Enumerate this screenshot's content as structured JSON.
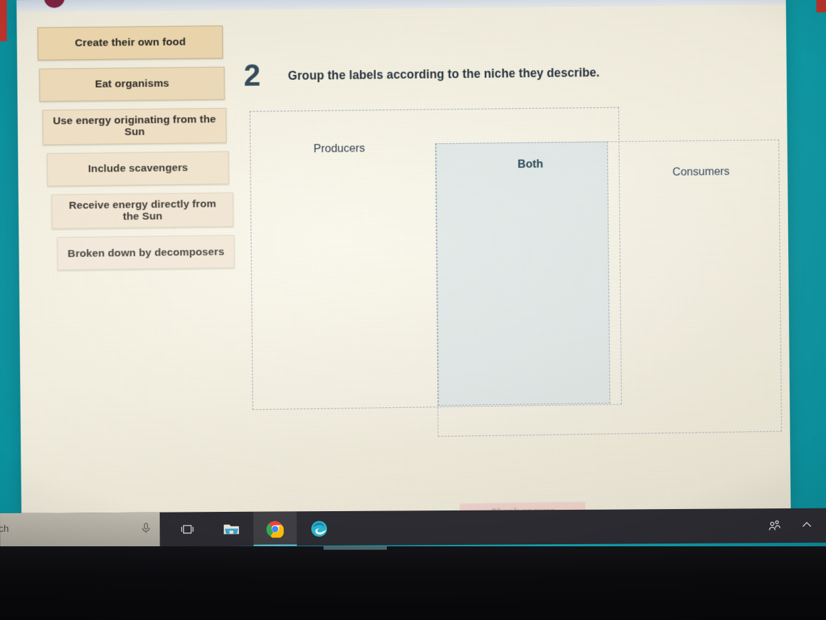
{
  "activity": {
    "question_number": "2",
    "prompt": "Group the labels according to the niche they describe.",
    "labels": [
      {
        "text": "Create their own food"
      },
      {
        "text": "Eat organisms"
      },
      {
        "text": "Use energy originating from the Sun"
      },
      {
        "text": "Include scavengers"
      },
      {
        "text": "Receive energy directly from the Sun"
      },
      {
        "text": "Broken down by decomposers"
      }
    ],
    "drop_zones": [
      {
        "name": "Producers",
        "fill": "#f6f3e7"
      },
      {
        "name": "Both",
        "fill": "#c1d6e5"
      },
      {
        "name": "Consumers",
        "fill": "#f3efe2"
      }
    ],
    "action_button": "Check answer",
    "accent_color": "#2f4858",
    "card_color": "#e9d7b4"
  },
  "taskbar": {
    "search_text": "ch",
    "icons": [
      {
        "name": "microphone-icon"
      },
      {
        "name": "task-view-icon"
      },
      {
        "name": "file-explorer-icon"
      },
      {
        "name": "google-chrome-icon"
      },
      {
        "name": "microsoft-edge-icon"
      }
    ],
    "tray": [
      {
        "name": "meet-now-people-icon"
      },
      {
        "name": "show-hidden-icons-chevron"
      }
    ]
  },
  "desktop": {
    "wallpaper_color": "#0e9aa6"
  }
}
